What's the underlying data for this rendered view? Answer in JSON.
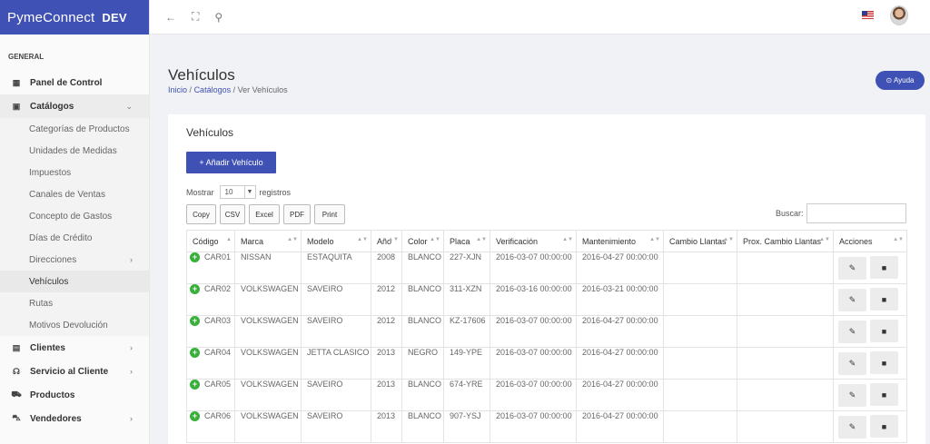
{
  "brand": {
    "name": "PymeConnect",
    "badge": "DEV"
  },
  "sidebar": {
    "section": "GENERAL",
    "items": [
      {
        "label": "Panel de Control",
        "icon": "dashboard-icon",
        "glyph": "▦"
      },
      {
        "label": "Catálogos",
        "icon": "book-icon",
        "glyph": "▣",
        "chevron": "⌄"
      }
    ],
    "sub_items": [
      {
        "label": "Categorías de Productos"
      },
      {
        "label": "Unidades de Medidas"
      },
      {
        "label": "Impuestos"
      },
      {
        "label": "Canales de Ventas"
      },
      {
        "label": "Concepto de Gastos"
      },
      {
        "label": "Días de Crédito"
      },
      {
        "label": "Direcciones",
        "chevron": "›"
      },
      {
        "label": "Vehículos"
      },
      {
        "label": "Rutas"
      },
      {
        "label": "Motivos Devolución"
      }
    ],
    "bottom_items": [
      {
        "label": "Clientes",
        "icon": "id-card-icon",
        "glyph": "▤",
        "chevron": "›"
      },
      {
        "label": "Servicio al Cliente",
        "icon": "headset-icon",
        "glyph": "☊",
        "chevron": "›"
      },
      {
        "label": "Productos",
        "icon": "cart-icon",
        "glyph": "⛟"
      },
      {
        "label": "Vendedores",
        "icon": "car-icon",
        "glyph": "⛍",
        "chevron": "›"
      }
    ]
  },
  "topbar": {
    "back": "←",
    "fullscreen": "⛶",
    "search": "⚲"
  },
  "header": {
    "title": "Vehículos",
    "breadcrumb": [
      "Inicio",
      "Catálogos",
      "Ver Vehículos"
    ],
    "sep": "/",
    "help": "⊙ Ayuda"
  },
  "card": {
    "title": "Vehículos",
    "add_button": "+  Añadir Vehículo",
    "show_label": "Mostrar",
    "show_value": "10",
    "records_label": "registros",
    "export_buttons": [
      "Copy",
      "CSV",
      "Excel",
      "PDF",
      "Print"
    ],
    "search_label": "Buscar:"
  },
  "table": {
    "columns": [
      "Código",
      "Marca",
      "Modelo",
      "Año",
      "Color",
      "Placa",
      "Verificación",
      "Mantenimiento",
      "Cambio Llantas",
      "Prox. Cambio Llantas",
      "Acciones"
    ],
    "rows": [
      [
        "CAR01",
        "NISSAN",
        "ESTAQUITA",
        "2008",
        "BLANCO",
        "227-XJN",
        "2016-03-07 00:00:00",
        "2016-04-27 00:00:00",
        "",
        ""
      ],
      [
        "CAR02",
        "VOLKSWAGEN",
        "SAVEIRO",
        "2012",
        "BLANCO",
        "311-XZN",
        "2016-03-16 00:00:00",
        "2016-03-21 00:00:00",
        "",
        ""
      ],
      [
        "CAR03",
        "VOLKSWAGEN",
        "SAVEIRO",
        "2012",
        "BLANCO",
        "KZ-17606",
        "2016-03-07 00:00:00",
        "2016-04-27 00:00:00",
        "",
        ""
      ],
      [
        "CAR04",
        "VOLKSWAGEN",
        "JETTA CLASICO",
        "2013",
        "NEGRO",
        "149-YPE",
        "2016-03-07 00:00:00",
        "2016-04-27 00:00:00",
        "",
        ""
      ],
      [
        "CAR05",
        "VOLKSWAGEN",
        "SAVEIRO",
        "2013",
        "BLANCO",
        "674-YRE",
        "2016-03-07 00:00:00",
        "2016-04-27 00:00:00",
        "",
        ""
      ],
      [
        "CAR06",
        "VOLKSWAGEN",
        "SAVEIRO",
        "2013",
        "BLANCO",
        "907-YSJ",
        "2016-03-07 00:00:00",
        "2016-04-27 00:00:00",
        "",
        ""
      ]
    ]
  },
  "colors": {
    "primary": "#3f51b5",
    "expand": "#38b03a"
  }
}
